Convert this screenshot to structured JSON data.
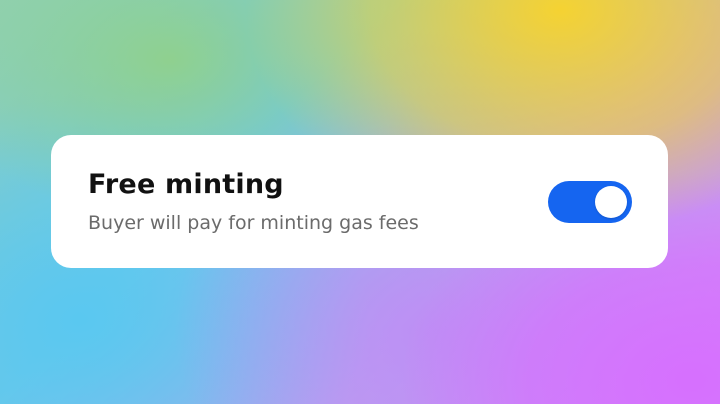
{
  "setting": {
    "title": "Free minting",
    "description": "Buyer will pay for minting gas fees",
    "toggle": {
      "state": "on",
      "accent_color": "#1565f0"
    }
  }
}
